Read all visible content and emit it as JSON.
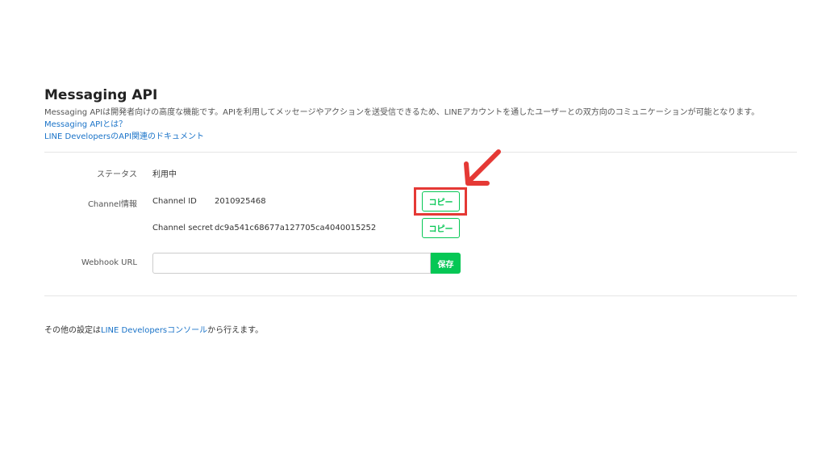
{
  "header": {
    "title": "Messaging API",
    "description": "Messaging APIは開発者向けの高度な機能です。APIを利用してメッセージやアクションを送受信できるため、LINEアカウントを通したユーザーとの双方向のコミュニケーションが可能となります。",
    "links": [
      "Messaging APIとは？",
      "LINE DevelopersのAPI関連のドキュメント"
    ]
  },
  "status": {
    "label": "ステータス",
    "value": "利用中"
  },
  "channel": {
    "label": "Channel情報",
    "id_label": "Channel ID",
    "id_value": "2010925468",
    "secret_label": "Channel secret",
    "secret_value": "dc9a541c68677a127705ca4040015252",
    "copy_label": "コピー"
  },
  "webhook": {
    "label": "Webhook URL",
    "value": "",
    "save_label": "保存"
  },
  "footer": {
    "prefix": "その他の設定は",
    "link": "LINE Developersコンソール",
    "suffix": "から行えます。"
  },
  "colors": {
    "accent": "#06c755",
    "link": "#1a73c8",
    "annotation": "#e53935"
  }
}
